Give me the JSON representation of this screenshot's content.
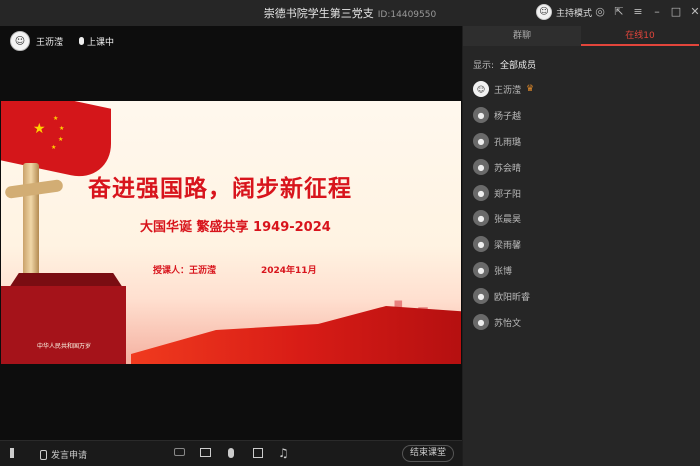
{
  "window": {
    "title": "崇德书院学生第三党支",
    "room_id": "ID:14409550",
    "mode_label": "主持模式"
  },
  "video": {
    "teacher_name": "王沥滢",
    "status": "上课中"
  },
  "slide": {
    "title": "奋进强国路，阔步新征程",
    "subtitle": "大国华诞 繁盛共享  1949-2024",
    "lecturer": "授课人：王沥滢",
    "date": "2024年11月",
    "gate_sign": "中华人民共和国万岁"
  },
  "toolbar": {
    "speak_request": "发言申请",
    "end_class": "结束课堂"
  },
  "panel": {
    "tabs": [
      {
        "label": "群聊"
      },
      {
        "label": "在线10"
      }
    ],
    "filter_label": "显示:",
    "filter_value": "全部成员",
    "members": [
      {
        "name": "王沥滢"
      },
      {
        "name": "杨子越"
      },
      {
        "name": "孔雨璐"
      },
      {
        "name": "苏会晴"
      },
      {
        "name": "郑子阳"
      },
      {
        "name": "张晨昊"
      },
      {
        "name": "梁雨馨"
      },
      {
        "name": "张博"
      },
      {
        "name": "欧阳昕睿"
      },
      {
        "name": "苏怡文"
      }
    ]
  },
  "colors": {
    "accent": "#e2453b",
    "slide_red": "#d8141c"
  }
}
